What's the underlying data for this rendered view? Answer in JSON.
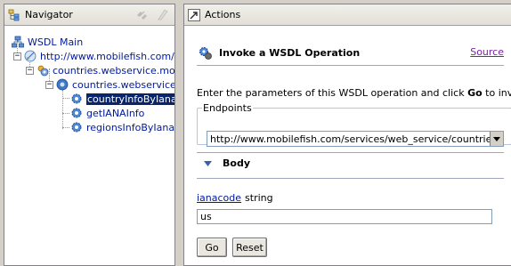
{
  "navigator": {
    "title": "Navigator",
    "tree": {
      "root": "WSDL Main",
      "url": "http://www.mobilefish.com/services/web_service/countries.php?wsdl",
      "service": "countries.webservice.mobilefish.com",
      "binding": "countries.webservice.mobilefish.com",
      "operations": [
        "countryInfoByIana",
        "getIANAInfo",
        "regionsInfoByIana"
      ],
      "selected_index": 0
    }
  },
  "actions": {
    "title": "Actions",
    "operation_title": "Invoke a WSDL Operation",
    "source_link": "Source",
    "instructions_prefix": "Enter the parameters of this WSDL operation and click ",
    "instructions_bold": "Go",
    "instructions_suffix": " to invoke.",
    "endpoints_label": "Endpoints",
    "endpoint_value": "http://www.mobilefish.com/services/web_service/countries.php",
    "body_label": "Body",
    "param_name": "ianacode",
    "param_type": "string",
    "param_value": "us",
    "go_label": "Go",
    "reset_label": "Reset"
  },
  "colors": {
    "link": "#00199a",
    "visited_link": "#7b1fa2",
    "selection": "#0a246a",
    "chrome": "#d4d0c8"
  },
  "icons": [
    "navigator-icon",
    "actions-icon",
    "wsdl-main-icon",
    "wsdl-url-icon",
    "service-icon",
    "binding-icon",
    "operation-gear-icon",
    "invoke-icon",
    "collapse-triangle-icon",
    "dropdown-arrow-icon"
  ]
}
